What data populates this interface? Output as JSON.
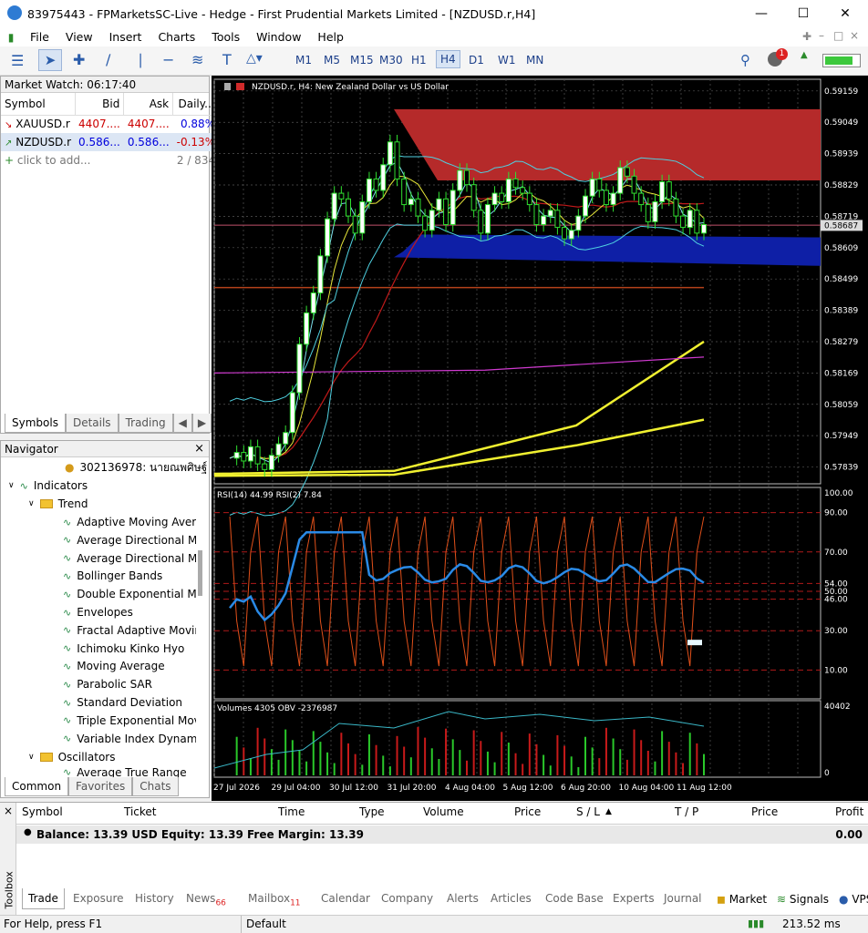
{
  "app": {
    "title": "83975443 - FPMarketsSC-Live - Hedge - First Prudential Markets Limited - [NZDUSD.r,H4]"
  },
  "menu": [
    "File",
    "View",
    "Insert",
    "Charts",
    "Tools",
    "Window",
    "Help"
  ],
  "timeframes": [
    "M1",
    "M5",
    "M15",
    "M30",
    "H1",
    "H4",
    "D1",
    "W1",
    "MN"
  ],
  "active_timeframe": "H4",
  "notification_count": "1",
  "market_watch": {
    "title": "Market Watch: 06:17:40",
    "columns": [
      "Symbol",
      "Bid",
      "Ask",
      "Daily..."
    ],
    "rows": [
      {
        "symbol": "XAUUSD.r",
        "bid": "4407....",
        "ask": "4407....",
        "daily": "0.88%",
        "dir": "down",
        "bid_color": "#cc0000",
        "daily_color": "#0000dd"
      },
      {
        "symbol": "NZDUSD.r",
        "bid": "0.586...",
        "ask": "0.586...",
        "daily": "-0.13%",
        "dir": "up",
        "bid_color": "#0000dd",
        "daily_color": "#cc0000"
      }
    ],
    "add_label": "click to add...",
    "count": "2 / 834",
    "tabs": [
      "Symbols",
      "Details",
      "Trading"
    ]
  },
  "navigator": {
    "title": "Navigator",
    "account": "302136978: นายณพศิษฐ์ ส",
    "indicators_label": "Indicators",
    "trend_label": "Trend",
    "trend_items": [
      "Adaptive Moving Avera",
      "Average Directional Mo",
      "Average Directional Mo",
      "Bollinger Bands",
      "Double Exponential Mo",
      "Envelopes",
      "Fractal Adaptive Movin",
      "Ichimoku Kinko Hyo",
      "Moving Average",
      "Parabolic SAR",
      "Standard Deviation",
      "Triple Exponential Movi",
      "Variable Index Dynamic"
    ],
    "oscillators_label": "Oscillators",
    "osc_item": "Average True Range",
    "tabs": [
      "Common",
      "Favorites",
      "Chats"
    ]
  },
  "chart": {
    "header": "NZDUSD.r, H4:  New Zealand Dollar vs US Dollar",
    "price_labels": [
      "0.59159",
      "0.59049",
      "0.58939",
      "0.58829",
      "0.58719",
      "0.58609",
      "0.58499",
      "0.58389",
      "0.58279",
      "0.58169",
      "0.58059",
      "0.57949",
      "0.57839"
    ],
    "current_price": "0.58687",
    "rsi_header": "RSI(14) 44.99 RSI(2) 7.84",
    "rsi_levels": [
      "100.00",
      "90.00",
      "70.00",
      "54.00",
      "50.00",
      "46.00",
      "30.00",
      "10.00"
    ],
    "vol_header": "Volumes 4305 OBV -2376987",
    "vol_max": "40402",
    "vol_min": "0",
    "time_labels": [
      "27 Jul 2026",
      "29 Jul 04:00",
      "30 Jul 12:00",
      "31 Jul 20:00",
      "4 Aug 04:00",
      "5 Aug 12:00",
      "6 Aug 20:00",
      "10 Aug 04:00",
      "11 Aug 12:00"
    ]
  },
  "chart_data": {
    "type": "candlestick",
    "title": "NZDUSD.r, H4:  New Zealand Dollar vs US Dollar",
    "close": [
      0.5787,
      0.5789,
      0.5786,
      0.5791,
      0.5785,
      0.5783,
      0.5788,
      0.5792,
      0.5796,
      0.581,
      0.5827,
      0.5838,
      0.5845,
      0.5858,
      0.5871,
      0.588,
      0.5878,
      0.5872,
      0.5866,
      0.5877,
      0.5885,
      0.5881,
      0.589,
      0.5898,
      0.5885,
      0.5876,
      0.5878,
      0.5872,
      0.5867,
      0.5874,
      0.5878,
      0.5869,
      0.5881,
      0.5888,
      0.5883,
      0.5874,
      0.5866,
      0.5876,
      0.588,
      0.5877,
      0.5885,
      0.5882,
      0.588,
      0.5876,
      0.5869,
      0.5872,
      0.5874,
      0.5868,
      0.5864,
      0.5867,
      0.5872,
      0.5879,
      0.5885,
      0.5881,
      0.5876,
      0.588,
      0.5889,
      0.5886,
      0.588,
      0.5876,
      0.587,
      0.5877,
      0.5884,
      0.5878,
      0.5872,
      0.5868,
      0.5874,
      0.5866,
      0.5869
    ],
    "ylim": [
      0.5778,
      0.592
    ],
    "rsi_levels": [
      10,
      30,
      46,
      50,
      54,
      70,
      90,
      100
    ]
  },
  "toolbox": {
    "columns": [
      "Symbol",
      "Ticket",
      "Time",
      "Type",
      "Volume",
      "Price",
      "S / L",
      "T / P",
      "Price",
      "Profit"
    ],
    "balance_line": "Balance: 13.39 USD  Equity: 13.39  Free Margin: 13.39",
    "profit": "0.00",
    "side_label": "Toolbox",
    "tabs": [
      {
        "label": "Trade",
        "badge": ""
      },
      {
        "label": "Exposure",
        "badge": ""
      },
      {
        "label": "History",
        "badge": ""
      },
      {
        "label": "News",
        "badge": "66"
      },
      {
        "label": "Mailbox",
        "badge": "11"
      },
      {
        "label": "Calendar",
        "badge": ""
      },
      {
        "label": "Company",
        "badge": ""
      },
      {
        "label": "Alerts",
        "badge": ""
      },
      {
        "label": "Articles",
        "badge": ""
      },
      {
        "label": "Code Base",
        "badge": ""
      },
      {
        "label": "Experts",
        "badge": ""
      },
      {
        "label": "Journal",
        "badge": ""
      }
    ],
    "right": {
      "market": "Market",
      "signals": "Signals",
      "vps": "VPS"
    }
  },
  "status": {
    "help": "For Help, press F1",
    "profile": "Default",
    "speed": "213.52 ms"
  }
}
